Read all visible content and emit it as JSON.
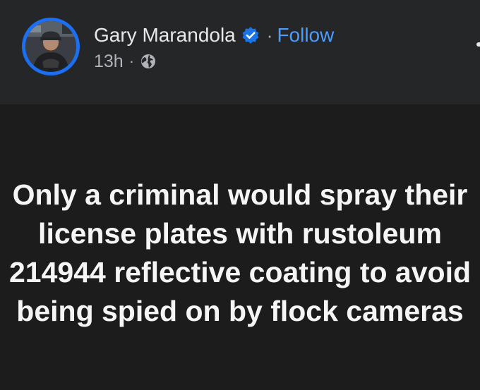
{
  "post": {
    "author_name": "Gary Marandola",
    "follow_label": "Follow",
    "separator": "·",
    "timestamp": "13h",
    "text": "Only a criminal would spray their license plates with rustoleum 214944 reflective coating to avoid being spied on by flock cameras"
  },
  "icons": {
    "verified": "verified-badge-icon",
    "audience": "globe-icon",
    "more": "more-options-icon"
  },
  "colors": {
    "background": "#1c1c1d",
    "header_background": "#252628",
    "accent": "#4a9cff",
    "avatar_ring": "#1b6ff0",
    "name_text": "#e7e8ea",
    "secondary_text": "#b0b3b8",
    "body_text": "#f5f5f5"
  }
}
